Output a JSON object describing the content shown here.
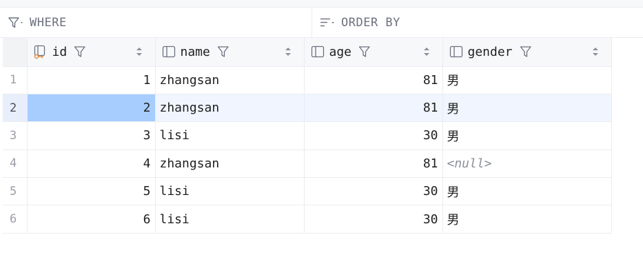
{
  "filter": {
    "where_label": "WHERE",
    "order_label": "ORDER BY"
  },
  "columns": [
    {
      "name": "id",
      "icon": "primary-key-column-icon"
    },
    {
      "name": "name",
      "icon": "column-icon"
    },
    {
      "name": "age",
      "icon": "column-icon"
    },
    {
      "name": "gender",
      "icon": "column-icon"
    }
  ],
  "rows": [
    {
      "num": "1",
      "id": "1",
      "name": "zhangsan",
      "age": "81",
      "gender": "男"
    },
    {
      "num": "2",
      "id": "2",
      "name": "zhangsan",
      "age": "81",
      "gender": "男"
    },
    {
      "num": "3",
      "id": "3",
      "name": "lisi",
      "age": "30",
      "gender": "男"
    },
    {
      "num": "4",
      "id": "4",
      "name": "zhangsan",
      "age": "81",
      "gender": "<null>"
    },
    {
      "num": "5",
      "id": "5",
      "name": "lisi",
      "age": "30",
      "gender": "男"
    },
    {
      "num": "6",
      "id": "6",
      "name": "lisi",
      "age": "30",
      "gender": "男"
    }
  ],
  "selection": {
    "row": 2,
    "column": "id"
  },
  "colors": {
    "selected_cell": "#a6cdfe",
    "selected_row": "#f0f5ff",
    "null_text": "#8c8f98",
    "key_icon": "#e08a3c"
  }
}
